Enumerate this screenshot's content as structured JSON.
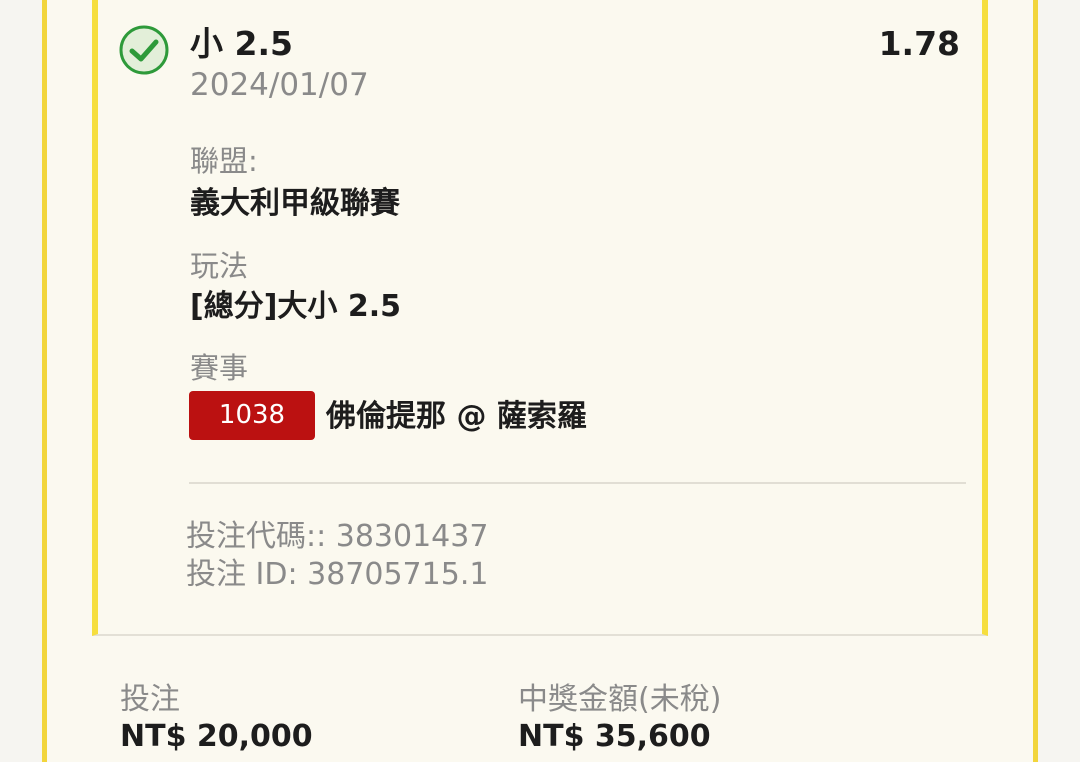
{
  "bet": {
    "selection": "小 2.5",
    "odds": "1.78",
    "date": "2024/01/07",
    "status_icon": "check-circle-icon",
    "status_color": "#2e9a3a"
  },
  "league": {
    "label": "聯盟:",
    "value": "義大利甲級聯賽"
  },
  "market": {
    "label": "玩法",
    "value": "[總分]大小 2.5"
  },
  "event": {
    "label": "賽事",
    "code": "1038",
    "name": "佛倫提那 @ 薩索羅",
    "badge_color": "#bb1111"
  },
  "ids": {
    "bet_code": "投注代碼:: 38301437",
    "bet_id": "投注 ID: 38705715.1"
  },
  "summary": {
    "stake_label": "投注",
    "stake_value": "NT$ 20,000",
    "payout_label": "中獎金額(未稅)",
    "payout_value": "NT$ 35,600"
  },
  "colors": {
    "frame_yellow": "#f2d53c",
    "background": "#fbf9f0"
  }
}
